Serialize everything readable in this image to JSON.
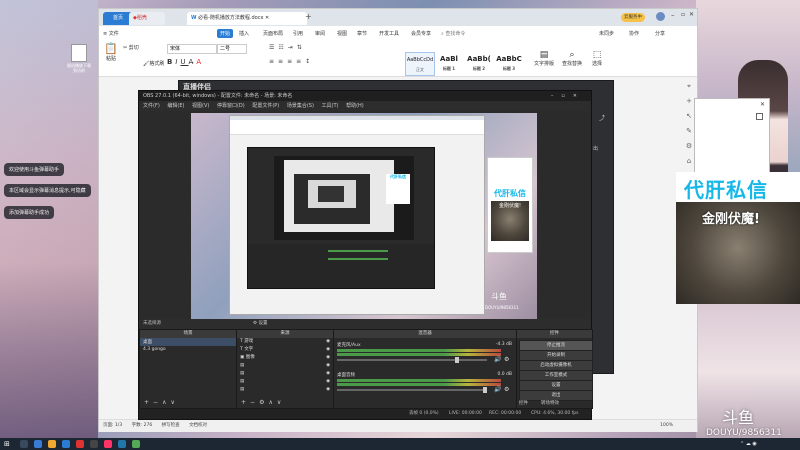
{
  "desktop": {
    "file_icon_label": "随机播放下载\n到访的",
    "notifications": [
      "欢迎使用斗鱼弹幕助手",
      "本区域会显示弹幕消息提示,可隐藏",
      "添加弹幕助手成功"
    ]
  },
  "wps": {
    "tabs": [
      {
        "label": "首页"
      },
      {
        "label": "稻壳"
      },
      {
        "label": "必看-随机播放方法教程.docx"
      }
    ],
    "new_tab": "+",
    "user_label": "云服务中",
    "menus": [
      "文件",
      "开始",
      "插入",
      "页面布局",
      "引用",
      "审阅",
      "视图",
      "章节",
      "开发工具",
      "会员专享"
    ],
    "search_placeholder": "查找命令",
    "right_menu": [
      "未同步",
      "协作",
      "分享"
    ],
    "font_name": "宋体",
    "font_size": "二号",
    "styles": [
      {
        "sample": "AaBbCcDd",
        "name": "正文"
      },
      {
        "sample": "AaBl",
        "name": "标题 1"
      },
      {
        "sample": "AaBb(",
        "name": "标题 2"
      },
      {
        "sample": "AaBbC",
        "name": "标题 3"
      }
    ],
    "ribbon_right": [
      "文字排版",
      "查找替换",
      "选择"
    ],
    "left_buttons": [
      "粘贴",
      "剪切",
      "格式刷"
    ],
    "status": {
      "page": "页面: 1/3",
      "words": "字数: 276",
      "spell": "拼写检查",
      "proof": "文档校对",
      "zoom": "100%"
    }
  },
  "obs": {
    "title": "OBS 27.0.1 (64-bit, windows) - 配置文件: 未命名 - 场景: 未命名",
    "menus": [
      "文件(F)",
      "编辑(E)",
      "视图(V)",
      "停靠窗口(D)",
      "配置文件(P)",
      "场景集合(S)",
      "工具(T)",
      "帮助(H)"
    ],
    "transition_label": "设置",
    "scenes": {
      "header": "场景",
      "items": [
        "桌面",
        "4.3 gongo"
      ],
      "dock_label": "未选择源"
    },
    "sources": {
      "header": "来源",
      "items": [
        "游戏",
        "文字",
        "图像",
        "",
        "",
        "",
        ""
      ]
    },
    "mixer": {
      "header": "混音器",
      "channels": [
        {
          "name": "麦克风/Aux",
          "db": "-4.3 dB"
        },
        {
          "name": "桌面音频",
          "db": "0.0 dB"
        }
      ]
    },
    "controls": {
      "header": "控件",
      "buttons": [
        "停止推流",
        "开始录制",
        "启动虚拟摄像机",
        "工作室模式",
        "设置",
        "退出"
      ]
    },
    "bottom_tabs": [
      "控件",
      "转场特效"
    ],
    "status": {
      "live": "LIVE: 00:00:00",
      "rec": "REC: 00:00:00",
      "cpu": "CPU: 4.6%, 30.00 fps",
      "kbps": "1290 kb/s",
      "frames": "丢帧 0 (0.0%)"
    }
  },
  "stream_panel": {
    "title_logo": "直播伴侣",
    "buttons": [
      "出",
      "退出"
    ],
    "promo_text": "代肝私信",
    "promo_sub": "金刚伏魔!",
    "mini_promo": "代肝私信",
    "mini_sub": "金刚伏魔!"
  },
  "douyu": {
    "logo": "斗鱼",
    "room": "DOUYU/9856311",
    "small_room": "DOUYU/9856311"
  },
  "colors": {
    "accent_blue": "#2b7cd3",
    "obs_bg": "#2b2b2b",
    "promo_blue": "#17b8e8",
    "promo_bg": "#ffffff",
    "taskbar": "#1d2633"
  }
}
